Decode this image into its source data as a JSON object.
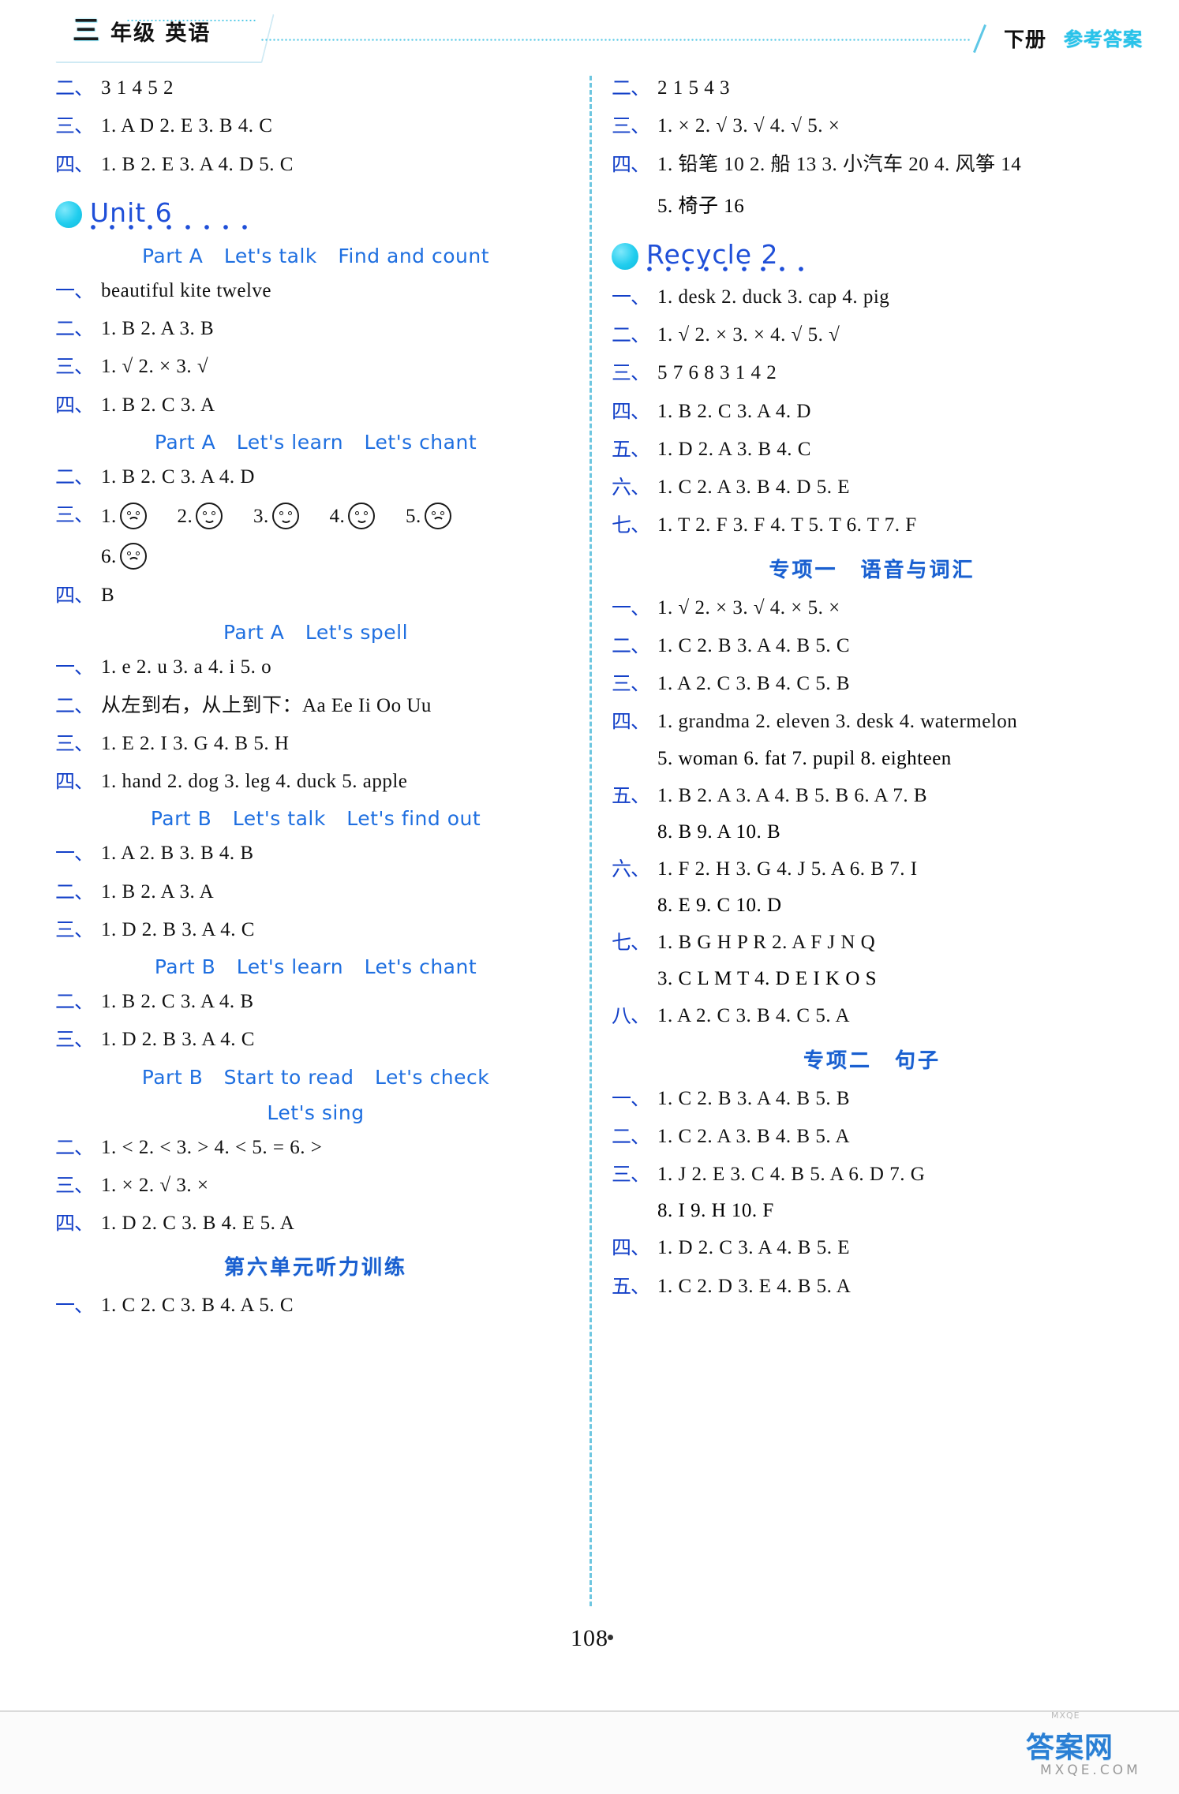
{
  "header": {
    "grade_number": "三",
    "grade_label": "年级  英语",
    "volume": "下册",
    "answer_label": "参考答案"
  },
  "footer": {
    "page_number": "108",
    "watermark_top": "MXQE",
    "watermark_brand": "答案网",
    "watermark_sub": "MXQE.COM"
  },
  "left_column": {
    "top_answers": [
      {
        "num": "二、",
        "body": "3  1  4  5  2"
      },
      {
        "num": "三、",
        "body": "1. A   D   2. E   3. B   4. C"
      },
      {
        "num": "四、",
        "body": "1. B   2. E   3. A   4. D   5. C"
      }
    ],
    "unit6": {
      "title": "Unit 6",
      "sections": [
        {
          "heading": [
            "Part A",
            "Let's talk",
            "Find and count"
          ],
          "answers": [
            {
              "num": "一、",
              "body": "beautiful   kite   twelve"
            },
            {
              "num": "二、",
              "body": "1. B   2. A   3. B"
            },
            {
              "num": "三、",
              "body": "1. √   2. ×   3. √"
            },
            {
              "num": "四、",
              "body": "1. B   2. C   3. A"
            }
          ]
        },
        {
          "heading": [
            "Part A",
            "Let's learn",
            "Let's chant"
          ],
          "answers": [
            {
              "num": "二、",
              "body": "1. B   2. C   3. A   4. D"
            }
          ],
          "faces_row": {
            "num": "三、",
            "items": [
              {
                "label": "1.",
                "mood": "sad"
              },
              {
                "label": "2.",
                "mood": "happy"
              },
              {
                "label": "3.",
                "mood": "happy"
              },
              {
                "label": "4.",
                "mood": "happy"
              },
              {
                "label": "5.",
                "mood": "sad"
              }
            ],
            "items_line2": [
              {
                "label": "6.",
                "mood": "sad"
              }
            ]
          },
          "answers_after": [
            {
              "num": "四、",
              "body": "B"
            }
          ]
        },
        {
          "heading": [
            "Part A",
            "Let's spell"
          ],
          "answers": [
            {
              "num": "一、",
              "body": "1. e   2. u   3. a   4. i   5. o"
            },
            {
              "num": "二、",
              "body": "从左到右，从上到下：Aa   Ee   Ii   Oo   Uu"
            },
            {
              "num": "三、",
              "body": "1. E   2. I   3. G   4. B   5. H"
            },
            {
              "num": "四、",
              "body": "1. hand   2. dog   3. leg   4. duck   5. apple"
            }
          ]
        },
        {
          "heading": [
            "Part B",
            "Let's talk",
            "Let's find out"
          ],
          "answers": [
            {
              "num": "一、",
              "body": "1. A   2. B   3. B   4. B"
            },
            {
              "num": "二、",
              "body": "1. B   2. A   3. A"
            },
            {
              "num": "三、",
              "body": "1. D   2. B   3. A   4. C"
            }
          ]
        },
        {
          "heading": [
            "Part B",
            "Let's learn",
            "Let's chant"
          ],
          "answers": [
            {
              "num": "二、",
              "body": "1. B   2. C   3. A   4. B"
            },
            {
              "num": "三、",
              "body": "1. D   2. B   3. A   4. C"
            }
          ]
        },
        {
          "heading": [
            "Part B",
            "Start to read",
            "Let's check"
          ],
          "heading2": [
            "Let's sing"
          ],
          "answers": [
            {
              "num": "二、",
              "body": "1. <   2. <   3. >   4. <   5. =   6. >"
            },
            {
              "num": "三、",
              "body": "1. ×   2. √   3. ×"
            },
            {
              "num": "四、",
              "body": "1. D   2. C   3. B   4. E   5. A"
            }
          ]
        }
      ]
    },
    "listening": {
      "title": "第六单元听力训练",
      "answers": [
        {
          "num": "一、",
          "body": "1. C   2. C   3. B   4. A   5. C"
        }
      ]
    }
  },
  "right_column": {
    "top_answers": [
      {
        "num": "二、",
        "body": "2  1  5  4  3"
      },
      {
        "num": "三、",
        "body": "1. ×   2. √   3. √   4. √   5. ×"
      },
      {
        "num": "四、",
        "body": "1. 铅笔 10   2. 船 13   3. 小汽车 20   4. 风筝 14"
      },
      {
        "num": "",
        "body": "5. 椅子 16",
        "continuation": true
      }
    ],
    "recycle2": {
      "title": "Recycle 2",
      "answers": [
        {
          "num": "一、",
          "body": "1. desk   2. duck   3. cap   4. pig"
        },
        {
          "num": "二、",
          "body": "1. √   2. ×   3. ×   4. √   5. √"
        },
        {
          "num": "三、",
          "body": "5  7  6  8  3  1  4  2"
        },
        {
          "num": "四、",
          "body": "1. B   2. C   3. A   4. D"
        },
        {
          "num": "五、",
          "body": "1. D   2. A   3. B   4. C"
        },
        {
          "num": "六、",
          "body": "1. C   2. A   3. B   4. D   5. E"
        },
        {
          "num": "七、",
          "body": "1. T   2. F   3. F   4. T   5. T   6. T   7. F"
        }
      ]
    },
    "special1": {
      "title": "专项一　语音与词汇",
      "answers": [
        {
          "num": "一、",
          "body": "1. √   2. ×   3. √   4. ×   5. ×"
        },
        {
          "num": "二、",
          "body": "1. C   2. B   3. A   4. B   5. C"
        },
        {
          "num": "三、",
          "body": "1. A   2. C   3. B   4. C   5. B"
        },
        {
          "num": "四、",
          "body": "1. grandma   2. eleven   3. desk   4. watermelon"
        },
        {
          "num": "",
          "body": "5. woman   6. fat   7. pupil   8. eighteen",
          "continuation": true
        },
        {
          "num": "五、",
          "body": "1. B   2. A   3. A   4. B   5. B   6. A   7. B"
        },
        {
          "num": "",
          "body": "8. B   9. A   10. B",
          "continuation": true
        },
        {
          "num": "六、",
          "body": "1. F   2. H   3. G   4. J   5. A   6. B   7. I"
        },
        {
          "num": "",
          "body": "8. E   9. C   10. D",
          "continuation": true
        },
        {
          "num": "七、",
          "body": "1. B G H P R   2. A F J N Q"
        },
        {
          "num": "",
          "body": "3. C L M T      4. D E I K O S",
          "continuation": true
        },
        {
          "num": "八、",
          "body": "1. A   2. C   3. B   4. C   5. A"
        }
      ]
    },
    "special2": {
      "title": "专项二　句子",
      "answers": [
        {
          "num": "一、",
          "body": "1. C   2. B   3. A   4. B   5. B"
        },
        {
          "num": "二、",
          "body": "1. C   2. A   3. B   4. B   5. A"
        },
        {
          "num": "三、",
          "body": "1. J   2. E   3. C   4. B   5. A   6. D   7. G"
        },
        {
          "num": "",
          "body": "8. I   9. H   10. F",
          "continuation": true
        },
        {
          "num": "四、",
          "body": "1. D   2. C   3. A   4. B   5. E"
        },
        {
          "num": "五、",
          "body": "1. C   2. D   3. E   4. B   5. A"
        }
      ]
    }
  }
}
